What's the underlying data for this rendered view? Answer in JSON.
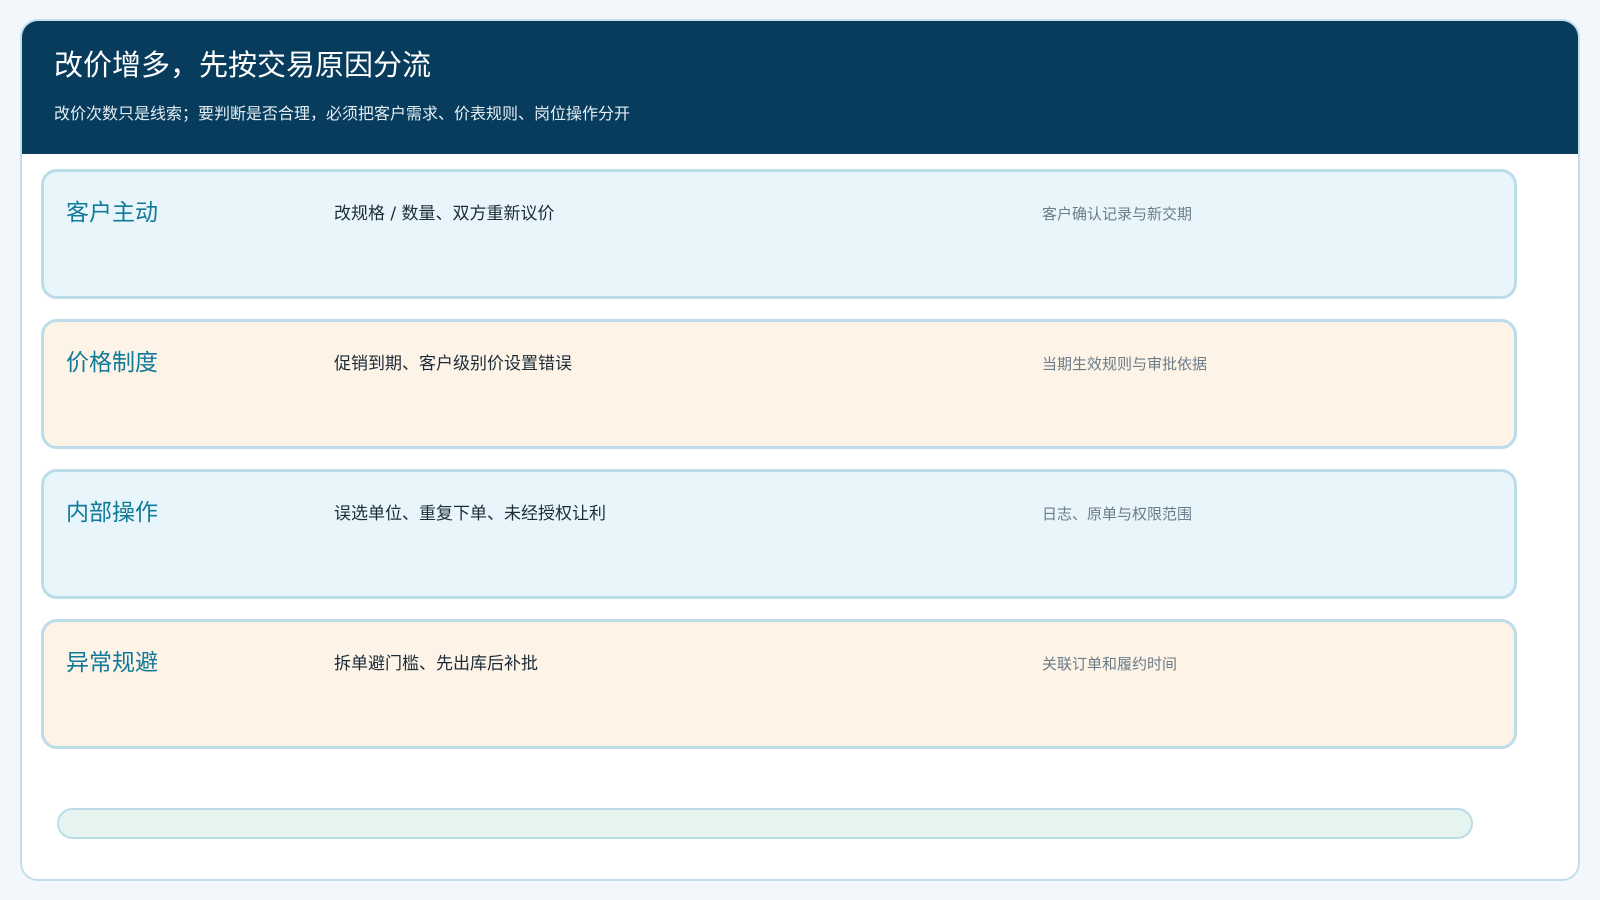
{
  "header": {
    "title": "改价增多，先按交易原因分流",
    "subtitle": "改价次数只是线索；要判断是否合理，必须把客户需求、价表规则、岗位操作分开"
  },
  "rows": [
    {
      "label": "客户主动",
      "desc": "改规格 / 数量、双方重新议价",
      "note": "客户确认记录与新交期",
      "tone": "blue"
    },
    {
      "label": "价格制度",
      "desc": "促销到期、客户级别价设置错误",
      "note": "当期生效规则与审批依据",
      "tone": "peach"
    },
    {
      "label": "内部操作",
      "desc": "误选单位、重复下单、未经授权让利",
      "note": "日志、原单与权限范围",
      "tone": "blue"
    },
    {
      "label": "异常规避",
      "desc": "拆单避门槛、先出库后补批",
      "note": "关联订单和履约时间",
      "tone": "peach"
    }
  ],
  "colors": {
    "header_bg": "#073c5d",
    "row_blue": "#e8f6fb",
    "row_peach": "#fdf3e7",
    "label_accent": "#117a99",
    "footer_bg": "#e6f4ef"
  }
}
